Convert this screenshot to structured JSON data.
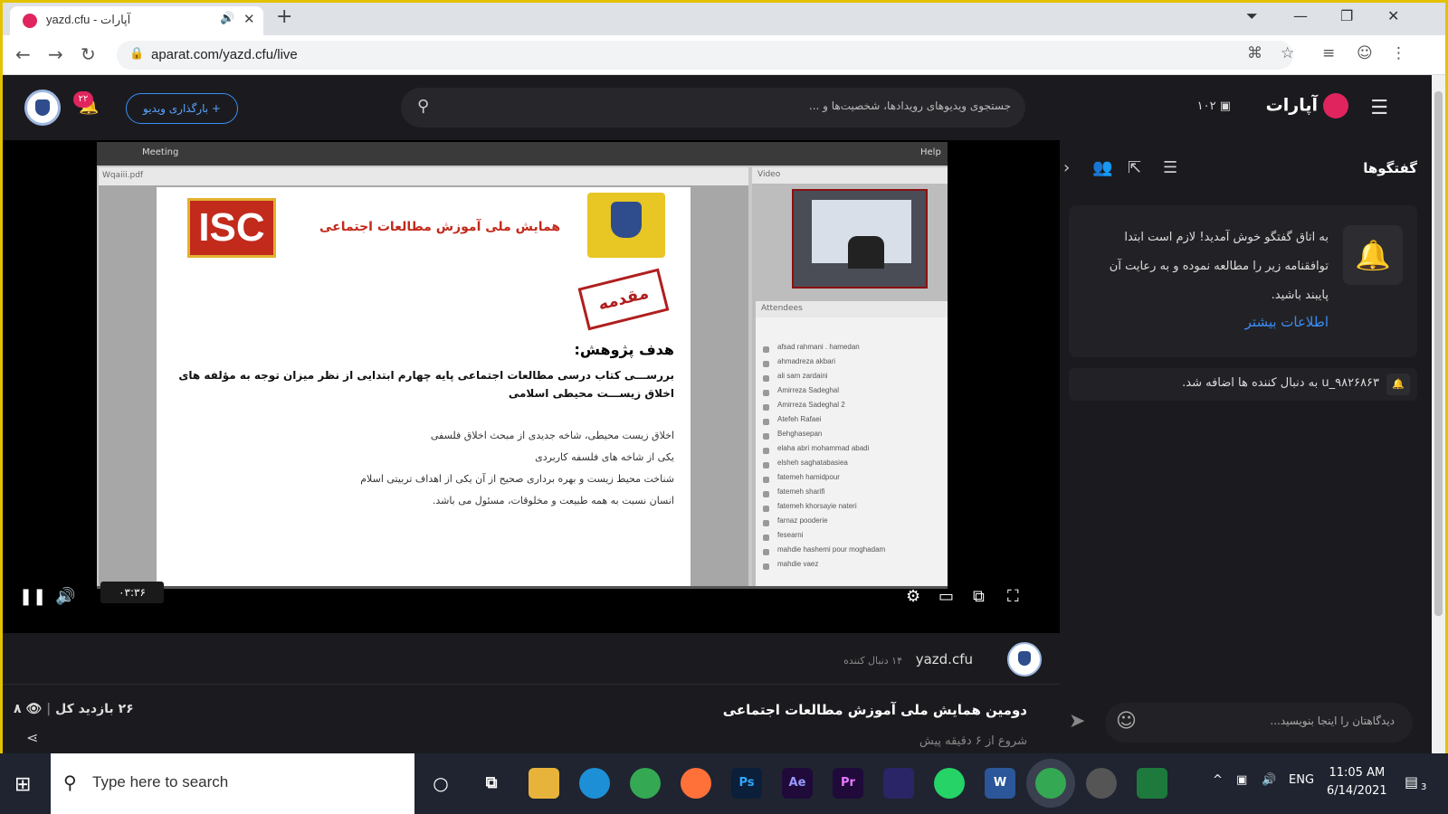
{
  "browser": {
    "tab_title": "yazd.cfu - آپارات",
    "url": "aparat.com/yazd.cfu/live"
  },
  "header": {
    "logo_text": "آپارات",
    "live_count": "۱۰۲",
    "search_placeholder": "جستجوی ویدیوهای رویدادها، شخصیت‌ها و ...",
    "upload_label": "+ بارگذاری ویدیو",
    "notification_count": "۲۲"
  },
  "player": {
    "time": "۰۳:۳۶",
    "meeting_menu": "Meeting",
    "help_menu": "Help",
    "pdf_name": "Wqaiii.pdf",
    "video_label": "Video",
    "attendees_label": "Attendees",
    "slide": {
      "logo_text": "ISC",
      "title": "همایش ملی آموزش مطالعات اجتماعی",
      "stamp": "مقدمه",
      "goal_heading": "هدف پژوهش:",
      "goal_body": "بررســـی کتاب درسی مطالعات اجتماعی پایه چهارم ابتدایی از نظر میزان توجه به مؤلفه های اخلاق زیســـت محیطی اسلامی",
      "items": [
        "اخلاق زیست محیطی، شاخه جدیدی از مبحث اخلاق فلسفی",
        "یکی از شاخه های فلسفه کاربردی",
        "شناخت محیط زیست و بهره برداری صحیح از آن یکی از اهداف تربیتی اسلام",
        "انسان نسبت به همه طبیعت و مخلوقات، مسئول می باشد."
      ]
    },
    "attendees": [
      "afsad rahmani . hamedan",
      "ahmadreza akbari",
      "ali sam zardaini",
      "Amirreza Sadeghal",
      "Amirreza Sadeghal 2",
      "Atefeh Rafaei",
      "Behghasepan",
      "elaha abri mohammad abadi",
      "elsheh saghatabasiea",
      "fatemeh hamidpour",
      "fatemeh sharifi",
      "fatemeh khorsayie nateri",
      "farnaz pooderie",
      "fesearni",
      "mahdie hashemi pour moghadam",
      "mahdie vaez"
    ]
  },
  "channel": {
    "name": "yazd.cfu",
    "followers": "۱۴ دنبال کننده"
  },
  "video": {
    "title": "دومین همایش ملی آموزش مطالعات اجتماعی",
    "started": "شروع از ۶ دقیقه پیش",
    "views": "۲۶ بازدید کل",
    "live_viewers": "۸"
  },
  "chat": {
    "title": "گفتگوها",
    "welcome": "به اتاق گفتگو خوش آمدید! لازم است ابتدا توافقنامه زیر را مطالعه نموده و به رعایت آن پایبند باشید.",
    "more_link": "اطلاعات بیشتر",
    "join_message": "u_۹۸۲۶۸۶۳ به دنبال کننده ها اضافه شد.",
    "input_placeholder": "دیدگاهتان را اینجا بنویسید..."
  },
  "taskbar": {
    "search_placeholder": "Type here to search",
    "language": "ENG",
    "time": "11:05 AM",
    "date": "6/14/2021",
    "notif_count": "3",
    "apps": [
      "Ps",
      "Ae",
      "Pr",
      "W"
    ]
  }
}
